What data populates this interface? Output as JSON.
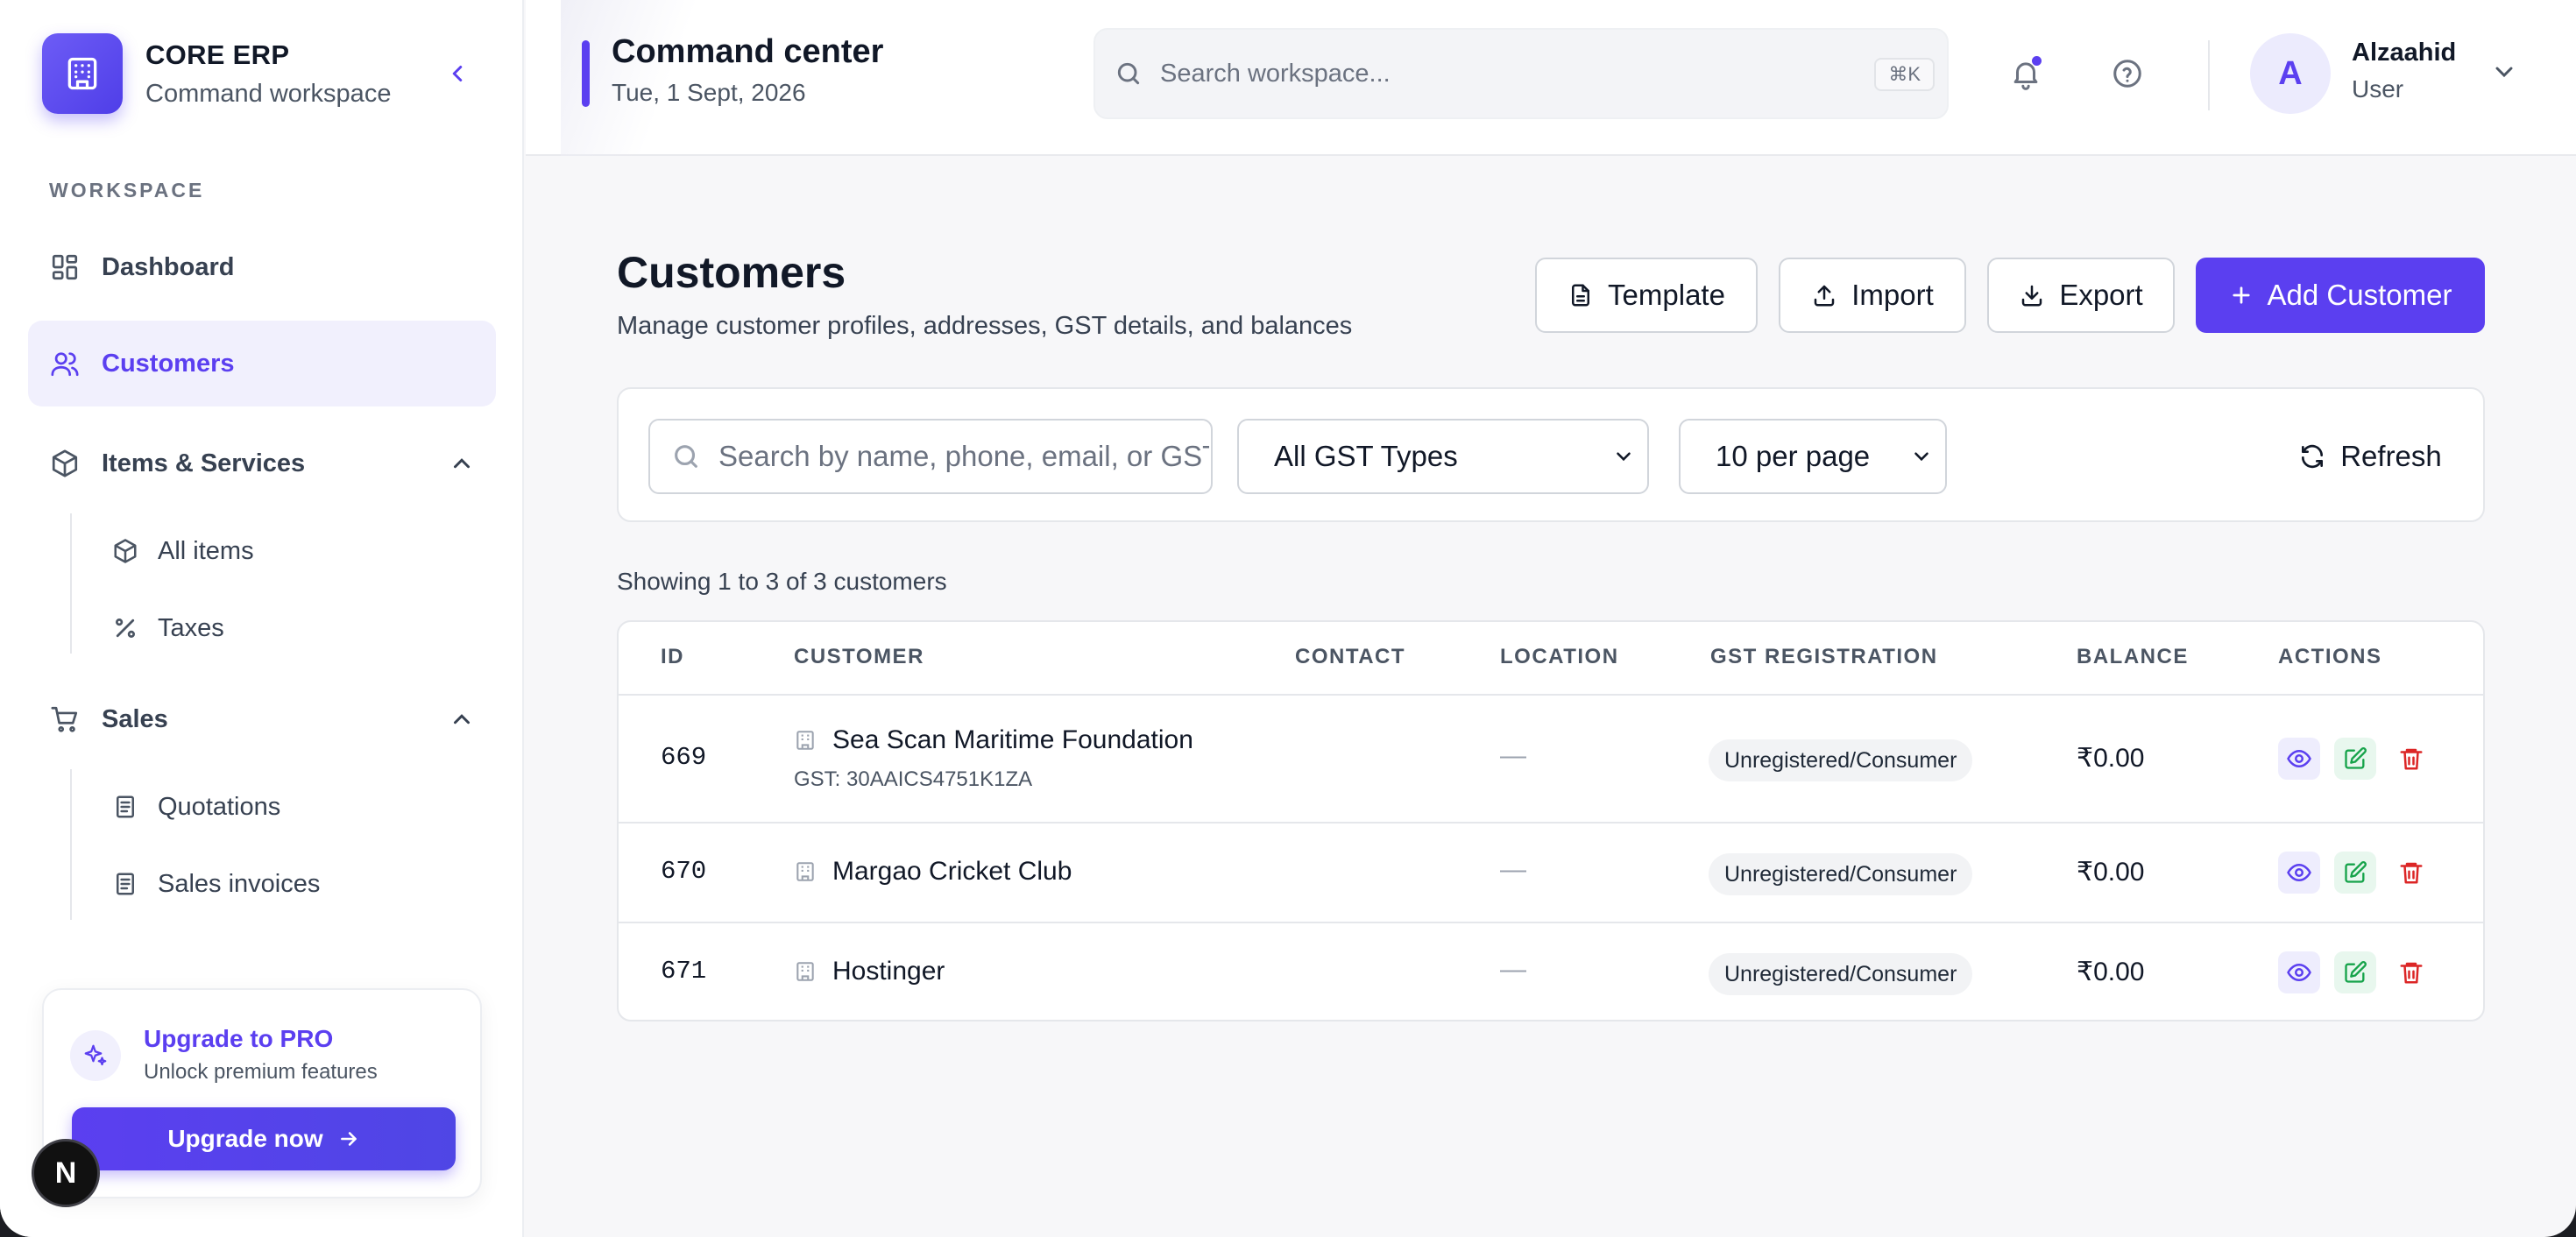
{
  "brand": {
    "name": "CORE ERP",
    "subtitle": "Command workspace"
  },
  "sidebar": {
    "section_label": "WORKSPACE",
    "items": [
      {
        "label": "Dashboard",
        "icon": "dashboard-icon"
      },
      {
        "label": "Customers",
        "icon": "users-icon",
        "active": true
      },
      {
        "label": "Items & Services",
        "icon": "box-icon",
        "expanded": true,
        "children": [
          {
            "label": "All items",
            "icon": "box-icon"
          },
          {
            "label": "Taxes",
            "icon": "percent-icon"
          }
        ]
      },
      {
        "label": "Sales",
        "icon": "cart-icon",
        "expanded": true,
        "children": [
          {
            "label": "Quotations",
            "icon": "document-icon"
          },
          {
            "label": "Sales invoices",
            "icon": "document-icon"
          }
        ]
      }
    ],
    "upgrade": {
      "title": "Upgrade to PRO",
      "subtitle": "Unlock premium features",
      "button": "Upgrade now"
    },
    "badge_letter": "N"
  },
  "header": {
    "title": "Command center",
    "date": "Tue, 1 Sept, 2026",
    "search_placeholder": "Search workspace...",
    "search_shortcut": "⌘K",
    "user": {
      "initial": "A",
      "name": "Alzaahid",
      "role": "User"
    }
  },
  "page": {
    "title": "Customers",
    "subtitle": "Manage customer profiles, addresses, GST details, and balances",
    "buttons": {
      "template": "Template",
      "import": "Import",
      "export": "Export",
      "add": "Add Customer"
    },
    "filters": {
      "search_placeholder": "Search by name, phone, email, or GST",
      "gst_type": "All GST Types",
      "per_page": "10 per page",
      "refresh": "Refresh"
    },
    "showing": "Showing 1 to 3 of 3 customers"
  },
  "table": {
    "columns": [
      "ID",
      "CUSTOMER",
      "CONTACT",
      "LOCATION",
      "GST REGISTRATION",
      "BALANCE",
      "ACTIONS"
    ],
    "rows": [
      {
        "id": "669",
        "customer": "Sea Scan Maritime Foundation",
        "gst": "GST: 30AAICS4751K1ZA",
        "contact": "",
        "location": "—",
        "gst_registration": "Unregistered/Consumer",
        "balance": "₹0.00"
      },
      {
        "id": "670",
        "customer": "Margao Cricket Club",
        "gst": "",
        "contact": "",
        "location": "—",
        "gst_registration": "Unregistered/Consumer",
        "balance": "₹0.00"
      },
      {
        "id": "671",
        "customer": "Hostinger",
        "gst": "",
        "contact": "",
        "location": "—",
        "gst_registration": "Unregistered/Consumer",
        "balance": "₹0.00"
      }
    ]
  },
  "colors": {
    "accent": "#5b3ff0",
    "edit": "#16a34a",
    "delete": "#dc2626"
  }
}
